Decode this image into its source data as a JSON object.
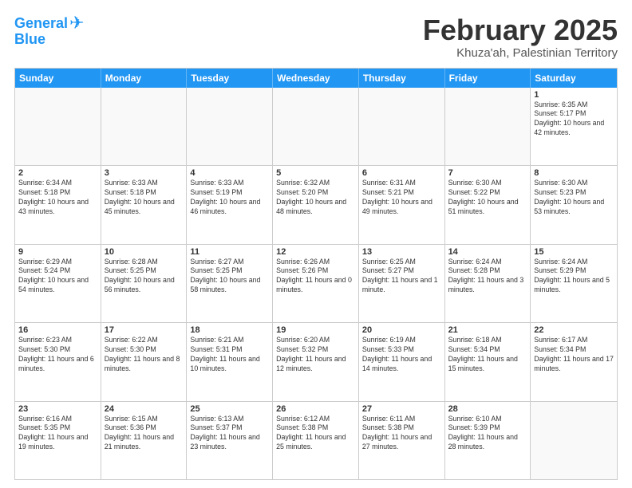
{
  "logo": {
    "line1": "General",
    "line2": "Blue"
  },
  "header": {
    "month": "February 2025",
    "location": "Khuza'ah, Palestinian Territory"
  },
  "weekdays": [
    "Sunday",
    "Monday",
    "Tuesday",
    "Wednesday",
    "Thursday",
    "Friday",
    "Saturday"
  ],
  "rows": [
    [
      {
        "day": "",
        "info": ""
      },
      {
        "day": "",
        "info": ""
      },
      {
        "day": "",
        "info": ""
      },
      {
        "day": "",
        "info": ""
      },
      {
        "day": "",
        "info": ""
      },
      {
        "day": "",
        "info": ""
      },
      {
        "day": "1",
        "info": "Sunrise: 6:35 AM\nSunset: 5:17 PM\nDaylight: 10 hours and 42 minutes."
      }
    ],
    [
      {
        "day": "2",
        "info": "Sunrise: 6:34 AM\nSunset: 5:18 PM\nDaylight: 10 hours and 43 minutes."
      },
      {
        "day": "3",
        "info": "Sunrise: 6:33 AM\nSunset: 5:18 PM\nDaylight: 10 hours and 45 minutes."
      },
      {
        "day": "4",
        "info": "Sunrise: 6:33 AM\nSunset: 5:19 PM\nDaylight: 10 hours and 46 minutes."
      },
      {
        "day": "5",
        "info": "Sunrise: 6:32 AM\nSunset: 5:20 PM\nDaylight: 10 hours and 48 minutes."
      },
      {
        "day": "6",
        "info": "Sunrise: 6:31 AM\nSunset: 5:21 PM\nDaylight: 10 hours and 49 minutes."
      },
      {
        "day": "7",
        "info": "Sunrise: 6:30 AM\nSunset: 5:22 PM\nDaylight: 10 hours and 51 minutes."
      },
      {
        "day": "8",
        "info": "Sunrise: 6:30 AM\nSunset: 5:23 PM\nDaylight: 10 hours and 53 minutes."
      }
    ],
    [
      {
        "day": "9",
        "info": "Sunrise: 6:29 AM\nSunset: 5:24 PM\nDaylight: 10 hours and 54 minutes."
      },
      {
        "day": "10",
        "info": "Sunrise: 6:28 AM\nSunset: 5:25 PM\nDaylight: 10 hours and 56 minutes."
      },
      {
        "day": "11",
        "info": "Sunrise: 6:27 AM\nSunset: 5:25 PM\nDaylight: 10 hours and 58 minutes."
      },
      {
        "day": "12",
        "info": "Sunrise: 6:26 AM\nSunset: 5:26 PM\nDaylight: 11 hours and 0 minutes."
      },
      {
        "day": "13",
        "info": "Sunrise: 6:25 AM\nSunset: 5:27 PM\nDaylight: 11 hours and 1 minute."
      },
      {
        "day": "14",
        "info": "Sunrise: 6:24 AM\nSunset: 5:28 PM\nDaylight: 11 hours and 3 minutes."
      },
      {
        "day": "15",
        "info": "Sunrise: 6:24 AM\nSunset: 5:29 PM\nDaylight: 11 hours and 5 minutes."
      }
    ],
    [
      {
        "day": "16",
        "info": "Sunrise: 6:23 AM\nSunset: 5:30 PM\nDaylight: 11 hours and 6 minutes."
      },
      {
        "day": "17",
        "info": "Sunrise: 6:22 AM\nSunset: 5:30 PM\nDaylight: 11 hours and 8 minutes."
      },
      {
        "day": "18",
        "info": "Sunrise: 6:21 AM\nSunset: 5:31 PM\nDaylight: 11 hours and 10 minutes."
      },
      {
        "day": "19",
        "info": "Sunrise: 6:20 AM\nSunset: 5:32 PM\nDaylight: 11 hours and 12 minutes."
      },
      {
        "day": "20",
        "info": "Sunrise: 6:19 AM\nSunset: 5:33 PM\nDaylight: 11 hours and 14 minutes."
      },
      {
        "day": "21",
        "info": "Sunrise: 6:18 AM\nSunset: 5:34 PM\nDaylight: 11 hours and 15 minutes."
      },
      {
        "day": "22",
        "info": "Sunrise: 6:17 AM\nSunset: 5:34 PM\nDaylight: 11 hours and 17 minutes."
      }
    ],
    [
      {
        "day": "23",
        "info": "Sunrise: 6:16 AM\nSunset: 5:35 PM\nDaylight: 11 hours and 19 minutes."
      },
      {
        "day": "24",
        "info": "Sunrise: 6:15 AM\nSunset: 5:36 PM\nDaylight: 11 hours and 21 minutes."
      },
      {
        "day": "25",
        "info": "Sunrise: 6:13 AM\nSunset: 5:37 PM\nDaylight: 11 hours and 23 minutes."
      },
      {
        "day": "26",
        "info": "Sunrise: 6:12 AM\nSunset: 5:38 PM\nDaylight: 11 hours and 25 minutes."
      },
      {
        "day": "27",
        "info": "Sunrise: 6:11 AM\nSunset: 5:38 PM\nDaylight: 11 hours and 27 minutes."
      },
      {
        "day": "28",
        "info": "Sunrise: 6:10 AM\nSunset: 5:39 PM\nDaylight: 11 hours and 28 minutes."
      },
      {
        "day": "",
        "info": ""
      }
    ]
  ]
}
